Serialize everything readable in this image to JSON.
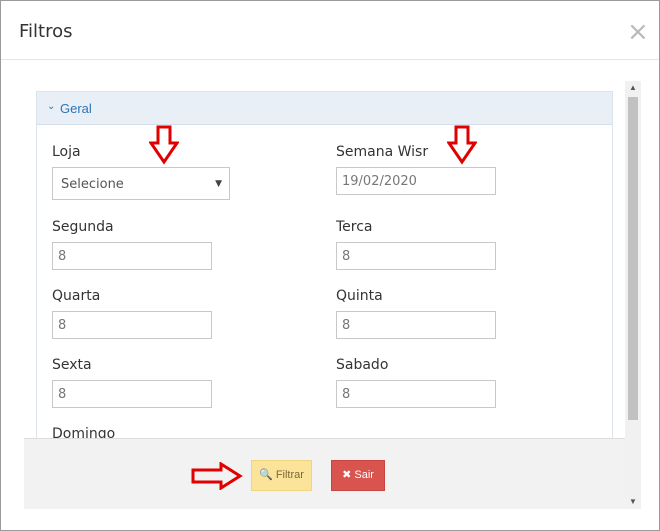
{
  "modal": {
    "title": "Filtros",
    "close_glyph": "×"
  },
  "panel": {
    "heading": "Geral",
    "heading_icon": "chevron-down-icon"
  },
  "fields": {
    "loja": {
      "label": "Loja",
      "value": "Selecione"
    },
    "semana": {
      "label": "Semana Wisr",
      "value": "19/02/2020"
    },
    "segunda": {
      "label": "Segunda",
      "value": "8"
    },
    "terca": {
      "label": "Terca",
      "value": "8"
    },
    "quarta": {
      "label": "Quarta",
      "value": "8"
    },
    "quinta": {
      "label": "Quinta",
      "value": "8"
    },
    "sexta": {
      "label": "Sexta",
      "value": "8"
    },
    "sabado": {
      "label": "Sabado",
      "value": "8"
    },
    "domingo": {
      "label": "Domingo"
    }
  },
  "footer": {
    "filter_label": "Filtrar",
    "exit_label": "Sair"
  },
  "colors": {
    "accent": "#2e75b5",
    "filter_button": "#fbe39a",
    "exit_button": "#d9534f",
    "annotation_arrow": "#e10000"
  }
}
